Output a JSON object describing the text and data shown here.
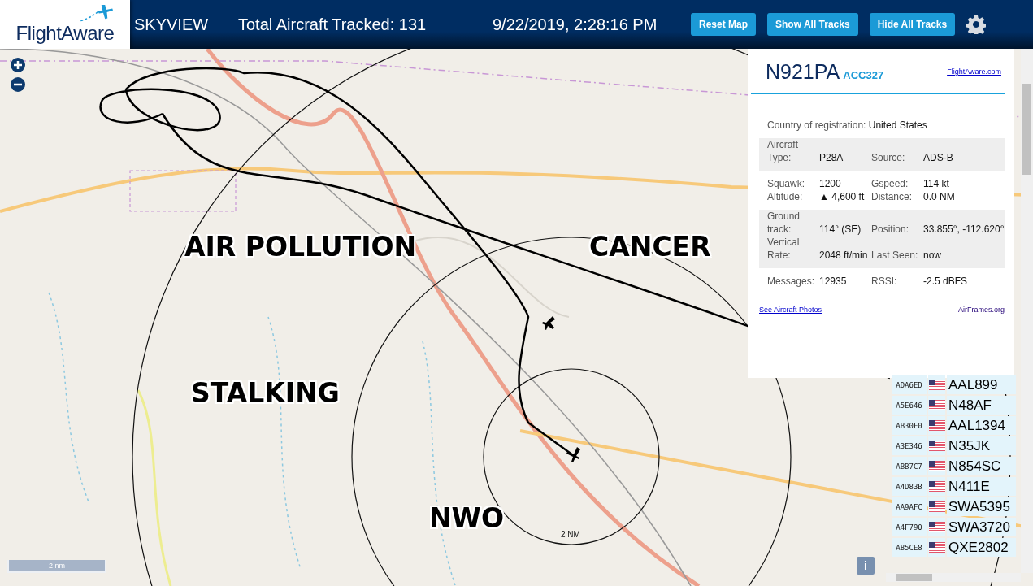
{
  "header": {
    "brand": "FlightAware",
    "app_name": "SKYVIEW",
    "total_tracked": "Total Aircraft Tracked: 131",
    "datetime": "9/22/2019, 2:28:16 PM",
    "buttons": [
      "Reset Map",
      "Show All Tracks",
      "Hide All Tracks"
    ]
  },
  "map": {
    "labels": [
      "AIR POLLUTION",
      "CANCER",
      "STALKING",
      "NWO"
    ],
    "ring_label": "2 NM",
    "scale": "2 nm",
    "info_button": "i"
  },
  "aircraft_info": {
    "registration": "N921PA",
    "callsign": "ACC327",
    "link": "FlightAware.com",
    "sections": [
      {
        "items": [
          {
            "label": "Country of registration:",
            "value": "United States"
          }
        ]
      },
      {
        "items": [
          {
            "label": "Aircraft Type:",
            "value": "P28A"
          },
          {
            "label": "Source:",
            "value": "ADS-B"
          }
        ]
      },
      {
        "items": [
          {
            "label": "Squawk:",
            "value": "1200"
          },
          {
            "label": "Gspeed:",
            "value": "114 kt"
          },
          {
            "label": "Altitude:",
            "value": "▲ 4,600 ft"
          },
          {
            "label": "Distance:",
            "value": "0.0 NM"
          }
        ]
      },
      {
        "items": [
          {
            "label": "Ground track:",
            "value": "114° (SE)"
          },
          {
            "label": "Position:",
            "value": "33.855°, -112.620°"
          },
          {
            "label": "Vertical Rate:",
            "value": "2048 ft/min"
          },
          {
            "label": "Last Seen:",
            "value": "now"
          }
        ]
      },
      {
        "items": [
          {
            "label": "Messages:",
            "value": "12935"
          },
          {
            "label": "RSSI:",
            "value": "-2.5 dBFS"
          }
        ]
      }
    ],
    "photos_link": "See Aircraft Photos",
    "airframes_link": "AirFrames.org"
  },
  "aircraft_table": {
    "rows": [
      {
        "hex": "ADA6ED",
        "callsign": "AAL899"
      },
      {
        "hex": "A5E646",
        "callsign": "N48AF"
      },
      {
        "hex": "AB30F0",
        "callsign": "AAL1394"
      },
      {
        "hex": "A3E346",
        "callsign": "N35JK"
      },
      {
        "hex": "ABB7C7",
        "callsign": "N854SC"
      },
      {
        "hex": "A4D83B",
        "callsign": "N411E"
      },
      {
        "hex": "AA9AFC",
        "callsign": "SWA5395"
      },
      {
        "hex": "A4F790",
        "callsign": "SWA3720"
      },
      {
        "hex": "A85CE8",
        "callsign": "QXE2802"
      }
    ]
  }
}
